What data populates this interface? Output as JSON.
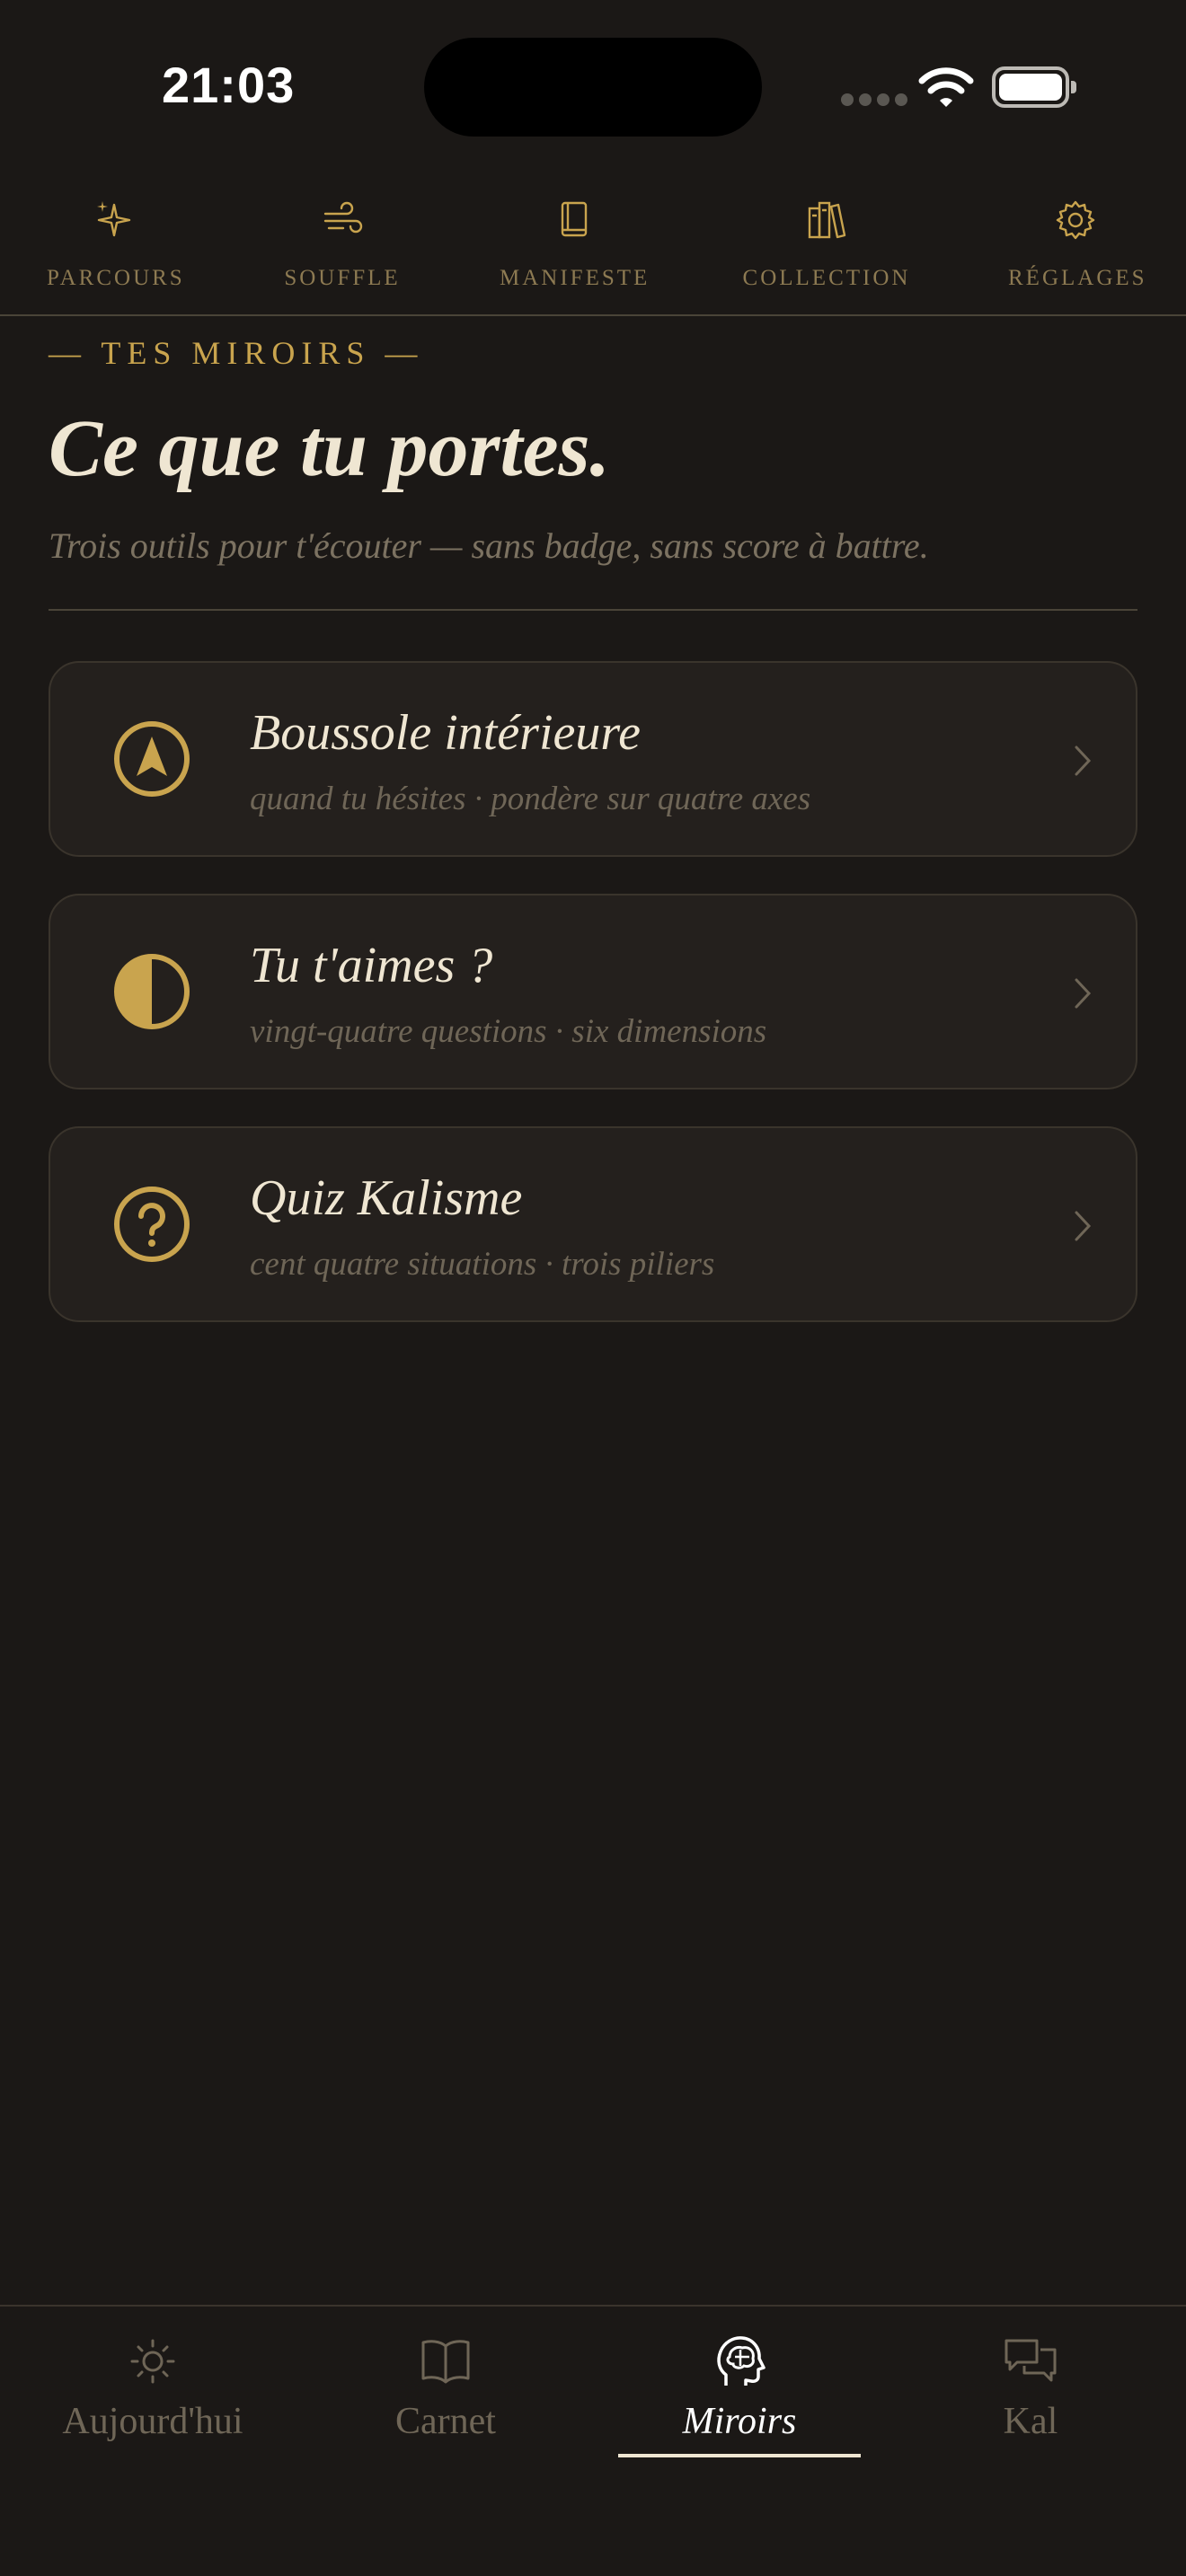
{
  "status_bar": {
    "time": "21:03"
  },
  "topnav": {
    "items": [
      {
        "label": "PARCOURS",
        "icon": "sparkles-icon"
      },
      {
        "label": "SOUFFLE",
        "icon": "wind-icon"
      },
      {
        "label": "MANIFESTE",
        "icon": "book-icon"
      },
      {
        "label": "COLLECTION",
        "icon": "library-icon"
      },
      {
        "label": "RÉGLAGES",
        "icon": "gear-icon"
      }
    ]
  },
  "header": {
    "eyebrow": "— TES MIROIRS —",
    "title": "Ce que tu portes.",
    "subtitle": "Trois outils pour t'écouter — sans badge, sans score à battre."
  },
  "cards": [
    {
      "title": "Boussole intérieure",
      "subtitle": "quand tu hésites · pondère sur quatre axes",
      "icon": "compass-icon"
    },
    {
      "title": "Tu t'aimes ?",
      "subtitle": "vingt-quatre questions · six dimensions",
      "icon": "half-circle-icon"
    },
    {
      "title": "Quiz Kalisme",
      "subtitle": "cent quatre situations · trois piliers",
      "icon": "question-icon"
    }
  ],
  "tabbar": {
    "items": [
      {
        "label": "Aujourd'hui",
        "icon": "sun-icon"
      },
      {
        "label": "Carnet",
        "icon": "open-book-icon"
      },
      {
        "label": "Miroirs",
        "icon": "brain-head-icon",
        "active": true
      },
      {
        "label": "Kal",
        "icon": "chat-bubbles-icon"
      }
    ]
  },
  "colors": {
    "background": "#1b1816",
    "accent": "#c9a44e",
    "card": "#24201d"
  }
}
